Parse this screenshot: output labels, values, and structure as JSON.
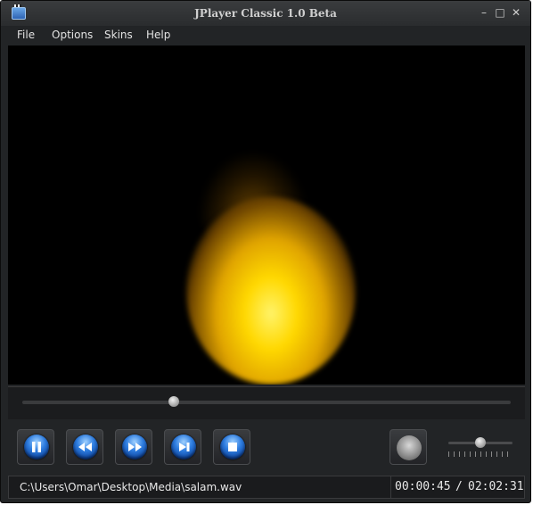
{
  "window": {
    "title": "JPlayer Classic 1.0 Beta",
    "minimize_icon": "minimize-icon",
    "maximize_icon": "maximize-icon",
    "close_icon": "close-icon",
    "app_icon": "clapperboard-icon"
  },
  "menu": {
    "items": [
      {
        "label": "File"
      },
      {
        "label": "Options"
      },
      {
        "label": "Skins"
      },
      {
        "label": "Help"
      }
    ]
  },
  "seek": {
    "progress": 0.31
  },
  "controls": {
    "buttons": [
      {
        "name": "pause-button",
        "icon": "pause-icon"
      },
      {
        "name": "rewind-button",
        "icon": "rewind-icon"
      },
      {
        "name": "fast-forward-button",
        "icon": "fast-forward-icon"
      },
      {
        "name": "next-button",
        "icon": "skip-next-icon"
      },
      {
        "name": "stop-button",
        "icon": "stop-icon"
      }
    ],
    "speaker_icon": "speaker-icon",
    "volume": 0.5
  },
  "status": {
    "file_path": "C:\\Users\\Omar\\Desktop\\Media\\salam.wav",
    "current_time": "00:00:45",
    "separator": "/",
    "total_time": "02:02:31"
  },
  "colors": {
    "accent_blue": "#2e7de0",
    "flame_yellow": "#ffd800",
    "background": "#222426"
  }
}
